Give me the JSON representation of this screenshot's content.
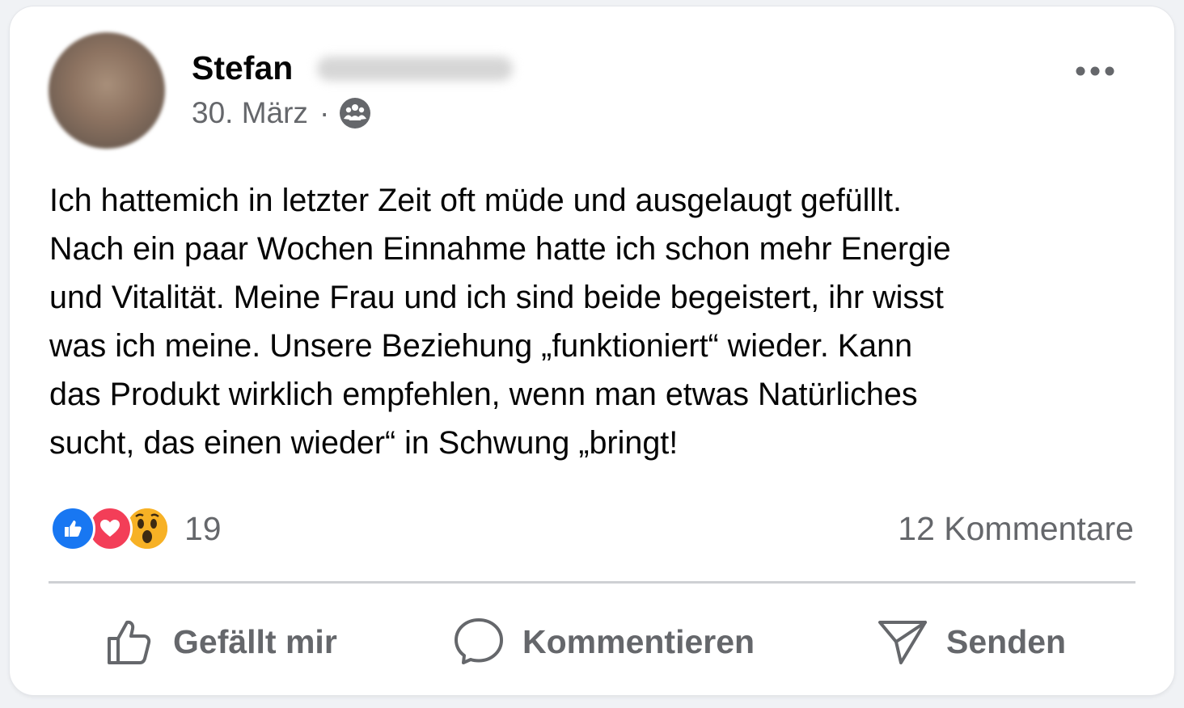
{
  "post": {
    "author": {
      "first_name": "Stefan"
    },
    "date": "30. März",
    "separator": "·",
    "audience_icon": "friends-icon",
    "more_icon": "more-dots-icon",
    "text_lines": [
      "Ich hattemich in letzter Zeit oft müde und ausgelaugt gefülllt.",
      "Nach ein paar Wochen Einnahme hatte ich schon mehr Energie",
      "und Vitalität. Meine Frau und ich sind beide begeistert, ihr wisst",
      "was ich meine. Unsere Beziehung „funktioniert“ wieder. Kann",
      "das Produkt wirklich empfehlen, wenn man etwas Natürliches",
      "sucht, das einen wieder“ in Schwung „bringt!"
    ]
  },
  "stats": {
    "reactions": [
      "like",
      "love",
      "wow"
    ],
    "reaction_count": "19",
    "comments": "12 Kommentare"
  },
  "actions": {
    "like_label": "Gefällt mir",
    "comment_label": "Kommentieren",
    "send_label": "Senden"
  },
  "colors": {
    "text": "#050505",
    "secondary": "#65676b",
    "like_blue": "#1877f2",
    "love_red": "#f33e58",
    "wow_yellow": "#f7b125",
    "divider": "#ced0d4"
  }
}
